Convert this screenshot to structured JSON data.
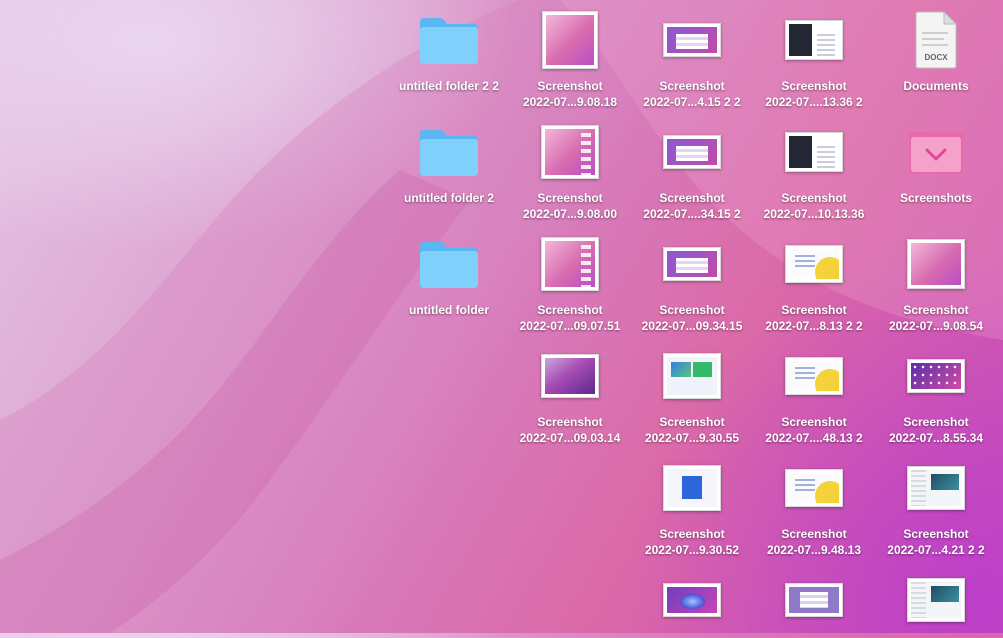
{
  "desktop": {
    "items": [
      {
        "id": "untitled-folder-2-2",
        "line1": "untitled folder 2 2",
        "line2": ""
      },
      {
        "id": "untitled-folder-2",
        "line1": "untitled folder 2",
        "line2": ""
      },
      {
        "id": "untitled-folder",
        "line1": "untitled folder",
        "line2": ""
      },
      {
        "id": "s1",
        "line1": "Screenshot",
        "line2": "2022-07...9.08.18"
      },
      {
        "id": "s2",
        "line1": "Screenshot",
        "line2": "2022-07...9.08.00"
      },
      {
        "id": "s3",
        "line1": "Screenshot",
        "line2": "2022-07...09.07.51"
      },
      {
        "id": "s4",
        "line1": "Screenshot",
        "line2": "2022-07...09.03.14"
      },
      {
        "id": "s5",
        "line1": "Screenshot",
        "line2": "2022-07...4.15 2 2"
      },
      {
        "id": "s6",
        "line1": "Screenshot",
        "line2": "2022-07....34.15 2"
      },
      {
        "id": "s7",
        "line1": "Screenshot",
        "line2": "2022-07...09.34.15"
      },
      {
        "id": "s8",
        "line1": "Screenshot",
        "line2": "2022-07...9.30.55"
      },
      {
        "id": "s9",
        "line1": "Screenshot",
        "line2": "2022-07...9.30.52"
      },
      {
        "id": "s10",
        "line1": "Screenshot",
        "line2": "2022-07....13.36 2"
      },
      {
        "id": "s11",
        "line1": "Screenshot",
        "line2": "2022-07...10.13.36"
      },
      {
        "id": "s12",
        "line1": "Screenshot",
        "line2": "2022-07...8.13 2 2"
      },
      {
        "id": "s13",
        "line1": "Screenshot",
        "line2": "2022-07....48.13 2"
      },
      {
        "id": "s14",
        "line1": "Screenshot",
        "line2": "2022-07...9.48.13"
      },
      {
        "id": "documents",
        "line1": "Documents",
        "line2": "",
        "badge": "DOCX"
      },
      {
        "id": "screenshots-folder",
        "line1": "Screenshots",
        "line2": ""
      },
      {
        "id": "s15",
        "line1": "Screenshot",
        "line2": "2022-07...9.08.54"
      },
      {
        "id": "s16",
        "line1": "Screenshot",
        "line2": "2022-07...8.55.34"
      },
      {
        "id": "s17",
        "line1": "Screenshot",
        "line2": "2022-07...4.21 2 2"
      }
    ]
  },
  "colors": {
    "folder": "#6cc4f8",
    "pink_folder": "#e86aa8"
  }
}
